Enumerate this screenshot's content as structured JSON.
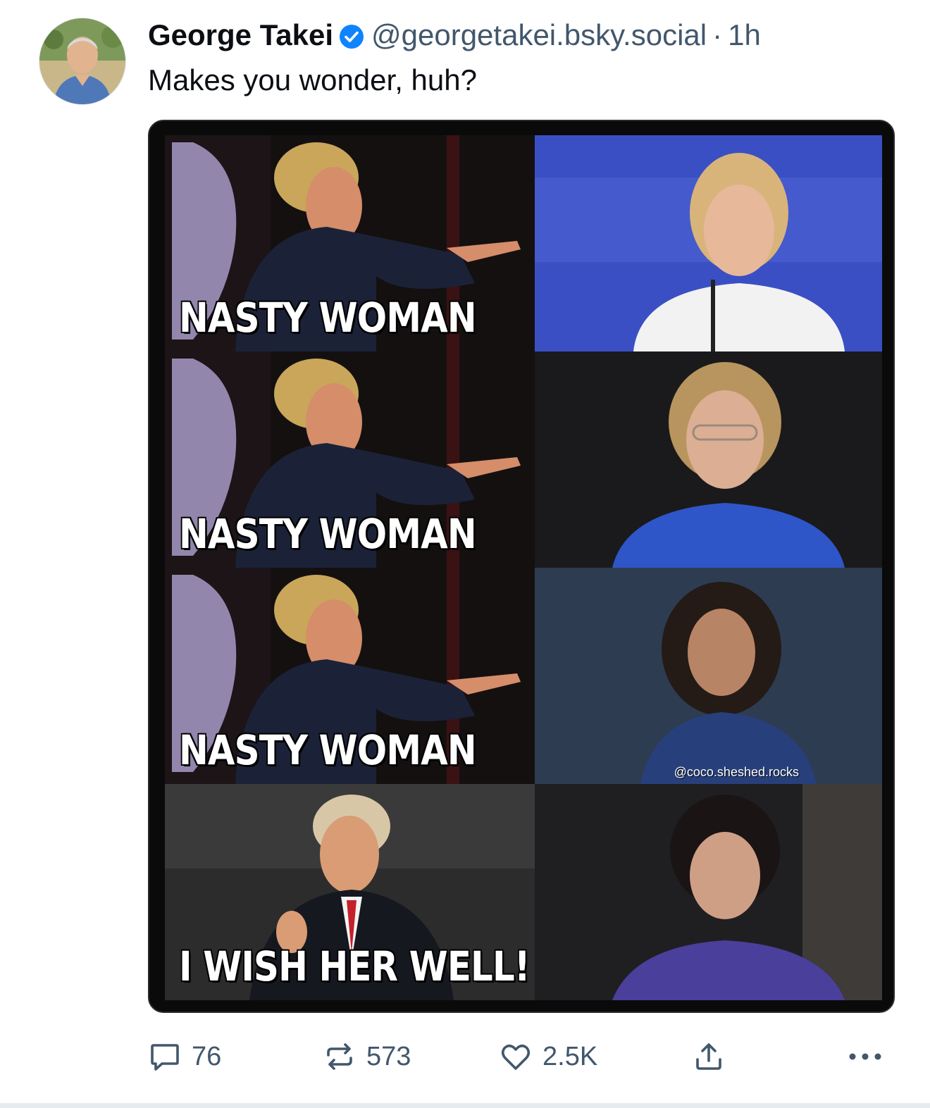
{
  "post": {
    "author_name": "George Takei",
    "handle": "@georgetakei.bsky.social",
    "separator": "·",
    "time": "1h",
    "text": "Makes you wonder, huh?"
  },
  "meme": {
    "captions": [
      "NASTY WOMAN",
      "NASTY WOMAN",
      "NASTY WOMAN",
      "I WISH HER WELL!"
    ],
    "watermark": "@coco.sheshed.rocks"
  },
  "actions": {
    "replies": "76",
    "reposts": "573",
    "likes": "2.5K"
  },
  "colors": {
    "accent": "#1083fe",
    "muted": "#42576c"
  },
  "icons": [
    "verified-badge-icon",
    "reply-icon",
    "repost-icon",
    "like-icon",
    "share-icon",
    "more-icon"
  ]
}
